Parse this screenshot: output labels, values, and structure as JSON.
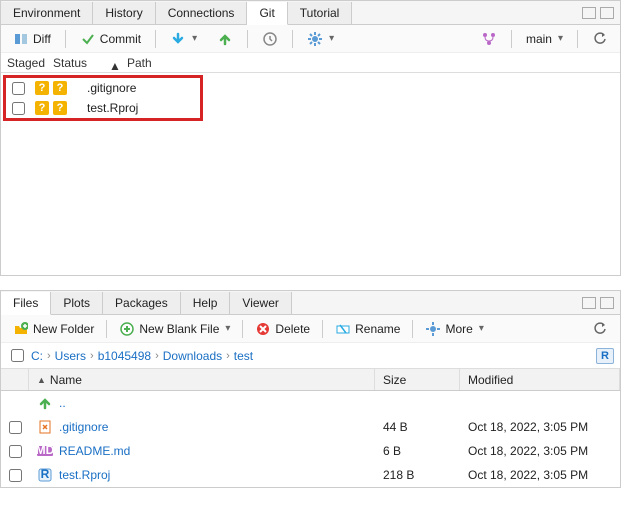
{
  "topPane": {
    "tabs": [
      "Environment",
      "History",
      "Connections",
      "Git",
      "Tutorial"
    ],
    "activeTab": 3,
    "toolbar": {
      "diff": "Diff",
      "commit": "Commit",
      "branch": "main"
    },
    "columns": {
      "staged": "Staged",
      "status": "Status",
      "path": "Path"
    },
    "rows": [
      {
        "file": ".gitignore"
      },
      {
        "file": "test.Rproj"
      }
    ]
  },
  "bottomPane": {
    "tabs": [
      "Files",
      "Plots",
      "Packages",
      "Help",
      "Viewer"
    ],
    "activeTab": 0,
    "toolbar": {
      "newFolder": "New Folder",
      "newBlank": "New Blank File",
      "delete": "Delete",
      "rename": "Rename",
      "more": "More"
    },
    "breadcrumb": [
      "C:",
      "Users",
      "b1045498",
      "Downloads",
      "test"
    ],
    "columns": {
      "name": "Name",
      "size": "Size",
      "modified": "Modified"
    },
    "rows": [
      {
        "up": true,
        "name": ".."
      },
      {
        "icon": "git",
        "name": ".gitignore",
        "size": "44 B",
        "modified": "Oct 18, 2022, 3:05 PM"
      },
      {
        "icon": "md",
        "name": "README.md",
        "size": "6 B",
        "modified": "Oct 18, 2022, 3:05 PM"
      },
      {
        "icon": "rproj",
        "name": "test.Rproj",
        "size": "218 B",
        "modified": "Oct 18, 2022, 3:05 PM"
      }
    ]
  }
}
